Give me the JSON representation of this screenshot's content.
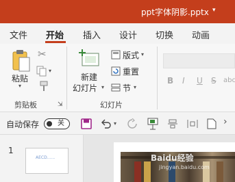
{
  "titlebar": {
    "title": "ppt字体阴影.pptx",
    "caret": "▾"
  },
  "tabs": [
    "文件",
    "开始",
    "插入",
    "设计",
    "切换",
    "动画"
  ],
  "clipboard": {
    "paste_label": "粘贴",
    "group_label": "剪贴板"
  },
  "slides_group": {
    "new_slide_line1": "新建",
    "new_slide_line2": "幻灯片",
    "layout_label": "版式",
    "reset_label": "重置",
    "section_label": "节",
    "group_label": "幻灯片"
  },
  "font_group": {
    "bold": "B",
    "italic": "I",
    "underline": "U",
    "strike": "S",
    "shadow": "abc"
  },
  "qat": {
    "autosave_label": "自动保存",
    "toggle_state": "关"
  },
  "thumbnails": {
    "slide_number": "1",
    "thumb_text": "AECD......"
  },
  "watermark": {
    "main": "Baidu经验",
    "sub": "jingyan.baidu.com"
  },
  "colors": {
    "accent": "#c43e1c"
  }
}
